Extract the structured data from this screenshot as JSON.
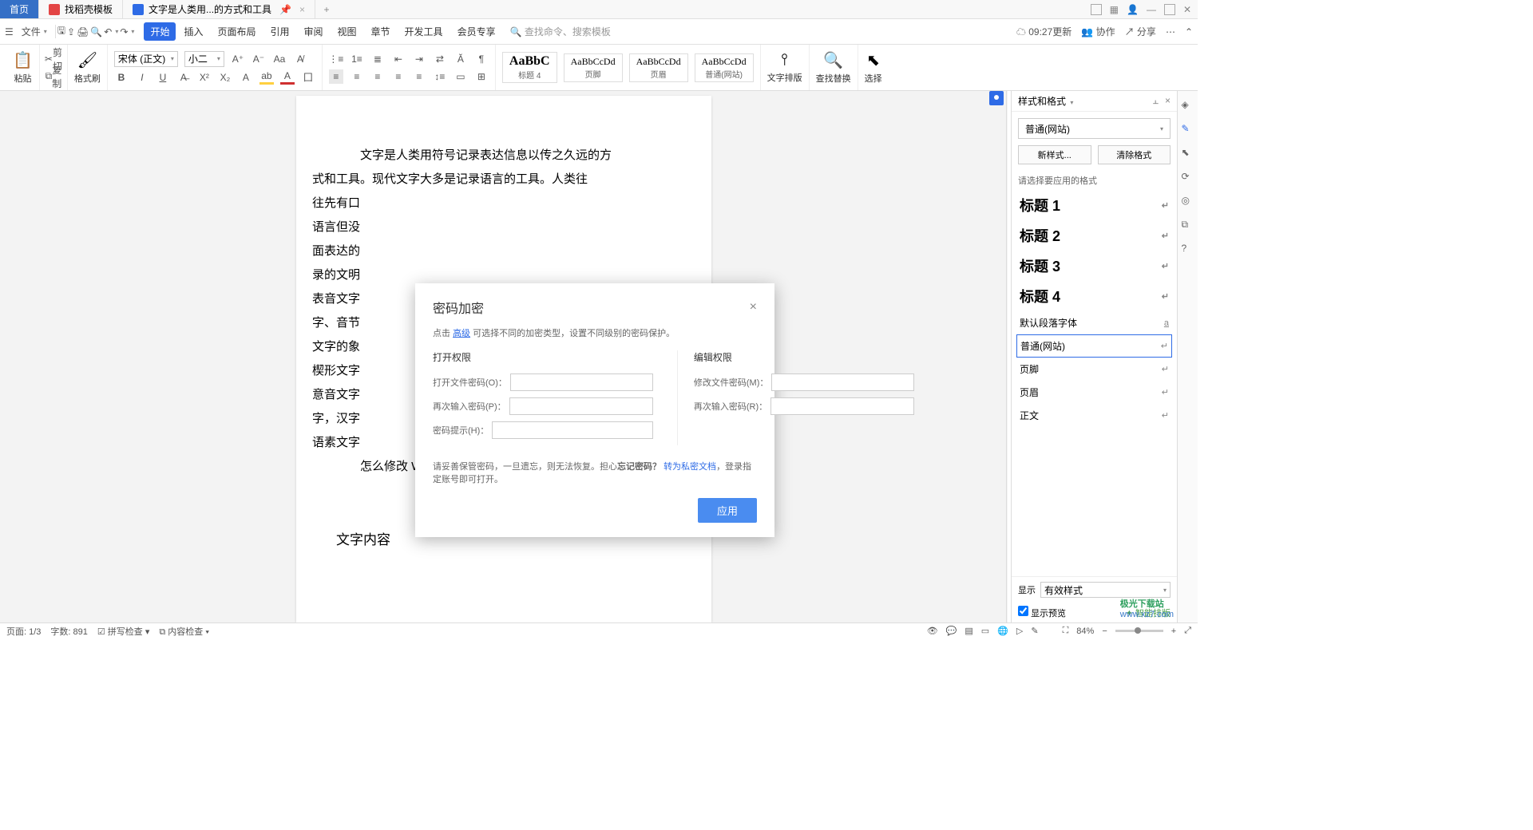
{
  "titlebar": {
    "tabs": [
      {
        "label": "首页",
        "kind": "home"
      },
      {
        "label": "找稻壳模板",
        "icon": "red"
      },
      {
        "label": "文字是人类用...的方式和工具",
        "icon": "blue",
        "active": true
      }
    ]
  },
  "menubar": {
    "file": "文件",
    "items": [
      "开始",
      "插入",
      "页面布局",
      "引用",
      "审阅",
      "视图",
      "章节",
      "开发工具",
      "会员专享"
    ],
    "search_placeholder": "查找命令、搜索模板",
    "update": "09:27更新",
    "coop": "协作",
    "share": "分享"
  },
  "toolbar": {
    "paste": "粘贴",
    "cut": "剪切",
    "copy": "复制",
    "brush": "格式刷",
    "font_name": "宋体 (正文)",
    "font_size": "小二",
    "style_preview": "AaBbC",
    "style_small": "AaBbCcDd",
    "style_names": [
      "标题 4",
      "页脚",
      "页眉",
      "普通(网站)"
    ],
    "typeset": "文字排版",
    "findrep": "查找替换",
    "select": "选择"
  },
  "document": {
    "p1": "文字是人类用符号记录表达信息以传之久远的方",
    "p1b": "式和工具。现代文字大多是记录语言的工具。人类往",
    "p1c": "往先有口",
    "p1d": "语言但没",
    "p1e": "面表达的",
    "p1f": "录的文明",
    "p1g": "表音文字",
    "p1h": "字、音节",
    "p1i": "文字的象",
    "p1j": "楔形文字",
    "p1k": "意音文字",
    "p1l": "字，汉字",
    "p1m": "语素文字",
    "p2": "怎么修改 Word 文档一打字就出现红色字体？",
    "p3": "文字内容"
  },
  "dialog": {
    "title": "密码加密",
    "hint_pre": "点击 ",
    "hint_link": "高级",
    "hint_post": " 可选择不同的加密类型，设置不同级别的密码保护。",
    "open_section": "打开权限",
    "edit_section": "编辑权限",
    "open_pw": "打开文件密码(O)：",
    "open_pw2": "再次输入密码(P)：",
    "open_hint": "密码提示(H)：",
    "edit_pw": "修改文件密码(M)：",
    "edit_pw2": "再次输入密码(R)：",
    "warn_pre": "请妥善保管密码，一旦遗忘，则无法恢复。担心",
    "warn_bold": "忘记密码？",
    "warn_link": "转为私密文档",
    "warn_post": "，登录指定账号即可打开。",
    "apply": "应用"
  },
  "sidebar": {
    "title": "样式和格式",
    "current": "普通(网站)",
    "new_style": "新样式...",
    "clear": "清除格式",
    "prompt": "请选择要应用的格式",
    "items": [
      "标题 1",
      "标题 2",
      "标题 3",
      "标题 4"
    ],
    "default_para": "默认段落字体",
    "selected": "普通(网站)",
    "more": [
      "页脚",
      "页眉",
      "正文"
    ],
    "show": "显示",
    "show_val": "有效样式",
    "preview": "显示预览",
    "smart": "智能排版"
  },
  "statusbar": {
    "page": "页面: 1/3",
    "words": "字数: 891",
    "spell": "拼写检查",
    "content": "内容检查",
    "zoom": "84%"
  },
  "watermark": {
    "top": "极光下载站",
    "url": "www.xz7.com"
  }
}
